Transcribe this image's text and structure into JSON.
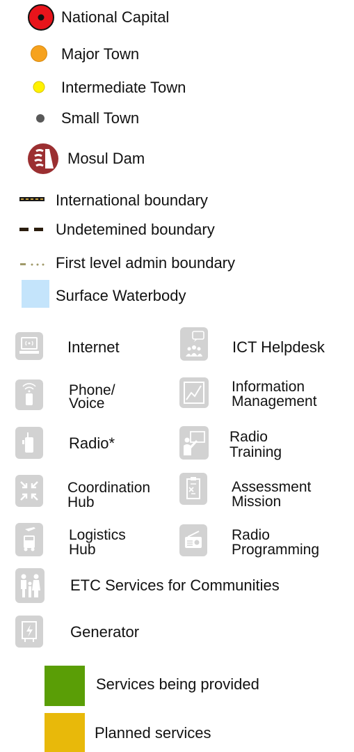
{
  "legend": {
    "settlements": {
      "national_capital": "National Capital",
      "major_town": "Major Town",
      "intermediate_town": "Intermediate Town",
      "small_town": "Small Town",
      "mosul_dam": "Mosul Dam"
    },
    "boundaries": {
      "international": "International boundary",
      "undetermined": "Undetemined boundary",
      "first_level_admin": "First level admin boundary"
    },
    "water": {
      "surface_waterbody": "Surface Waterbody"
    },
    "ict_services": {
      "internet": "Internet",
      "ict_helpdesk": "ICT Helpdesk",
      "phone_voice_line1": "Phone/",
      "phone_voice_line2": "Voice",
      "information_management_line1": "Information",
      "information_management_line2": "Management",
      "radio": "Radio*",
      "radio_training_line1": "Radio",
      "radio_training_line2": "Training",
      "coordination_hub_line1": "Coordination",
      "coordination_hub_line2": "Hub",
      "assessment_mission_line1": "Assessment",
      "assessment_mission_line2": "Mission",
      "logistics_hub_line1": "Logistics",
      "logistics_hub_line2": "Hub",
      "radio_programming_line1": "Radio",
      "radio_programming_line2": "Programming",
      "etc_services_communities": "ETC Services for Communities",
      "generator": "Generator"
    },
    "status": {
      "provided": "Services being provided",
      "planned": "Planned services"
    }
  },
  "colors": {
    "national_capital_fill": "#e8141b",
    "major_town_fill": "#f6a21e",
    "intermediate_town_fill": "#fff200",
    "small_town_fill": "#595959",
    "dam_symbol": "#9b2f31",
    "international_boundary": "#1a1a1a",
    "international_boundary_accent": "#c8a03c",
    "undetermined_boundary": "#2b1d0e",
    "admin_boundary": "#a09a6a",
    "surface_waterbody": "#c4e4fb",
    "ict_icon_bg": "#d2d2d2",
    "services_provided": "#5a9e06",
    "planned_services": "#e8b90a"
  },
  "icons": {
    "internet": "internet-icon",
    "ict_helpdesk": "helpdesk-icon",
    "phone_voice": "phone-icon",
    "information_management": "chart-icon",
    "radio": "radio-handset-icon",
    "radio_training": "trainer-icon",
    "coordination_hub": "arrows-converge-icon",
    "assessment_mission": "clipboard-icon",
    "logistics_hub": "truck-plane-icon",
    "radio_programming": "radio-set-icon",
    "etc_services_communities": "family-icon",
    "generator": "generator-icon",
    "mosul_dam": "dam-icon"
  }
}
